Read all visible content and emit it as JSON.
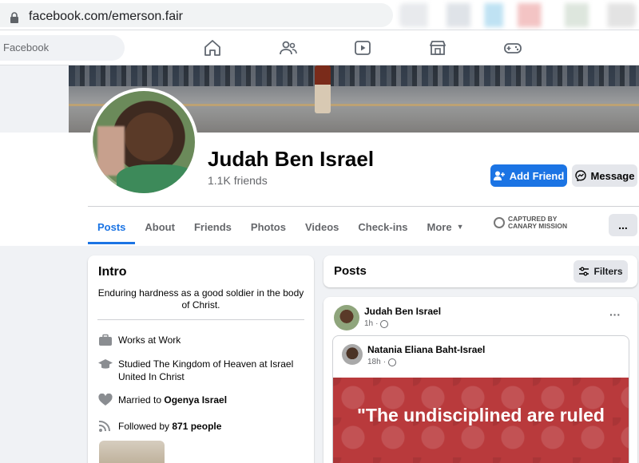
{
  "browser": {
    "url": "facebook.com/emerson.fair"
  },
  "fb_nav": {
    "search_text": "Facebook",
    "icons": [
      "home-icon",
      "friends-icon",
      "watch-icon",
      "marketplace-icon",
      "gaming-icon"
    ]
  },
  "profile": {
    "name": "Judah Ben Israel",
    "friends": "1.1K friends",
    "add_friend_label": "Add Friend",
    "message_label": "Message"
  },
  "tabs": [
    {
      "label": "Posts",
      "active": true
    },
    {
      "label": "About"
    },
    {
      "label": "Friends"
    },
    {
      "label": "Photos"
    },
    {
      "label": "Videos"
    },
    {
      "label": "Check-ins"
    },
    {
      "label": "More"
    }
  ],
  "capture_badge": {
    "line1": "CAPTURED BY",
    "line2": "CANARY MISSION"
  },
  "more_button": "...",
  "intro": {
    "title": "Intro",
    "bio": "Enduring hardness as a good soldier in the body of Christ.",
    "work_prefix": "Works at ",
    "work": "Work",
    "education": "Studied The Kingdom of Heaven at Israel United In Christ",
    "married_prefix": "Married to ",
    "married_to": "Ogenya Israel",
    "followed_prefix": "Followed by ",
    "followers": "871 people"
  },
  "posts_header": {
    "title": "Posts",
    "filters_label": "Filters"
  },
  "post": {
    "author": "Judah Ben Israel",
    "time": "1h",
    "shared_author": "Natania Eliana Baht-Israel",
    "shared_time": "18h",
    "quote_text": "\"The undisciplined are ruled"
  },
  "colors": {
    "primary": "#1b74e4",
    "background": "#f0f2f5",
    "quote_bg": "#b93a3c"
  }
}
